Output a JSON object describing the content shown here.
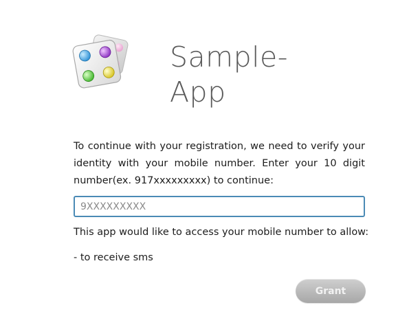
{
  "app": {
    "title_line1": "Sample-",
    "title_line2": "App",
    "logo_icon": "dice-icon"
  },
  "verification": {
    "instructions": "To continue with your registration, we need to verify your identity with your mobile number. Enter your 10 digit number(ex. 917xxxxxxxxx) to continue:",
    "phone_value": "",
    "phone_placeholder": "9XXXXXXXXX"
  },
  "permissions": {
    "heading": "This app would like to access your mobile number to allow:",
    "items": [
      "- to receive sms"
    ]
  },
  "actions": {
    "grant_label": "Grant"
  },
  "colors": {
    "input_border": "#4a8ab5",
    "button_gray": "#b9b9b9",
    "title_gray": "#5a5a5a"
  }
}
